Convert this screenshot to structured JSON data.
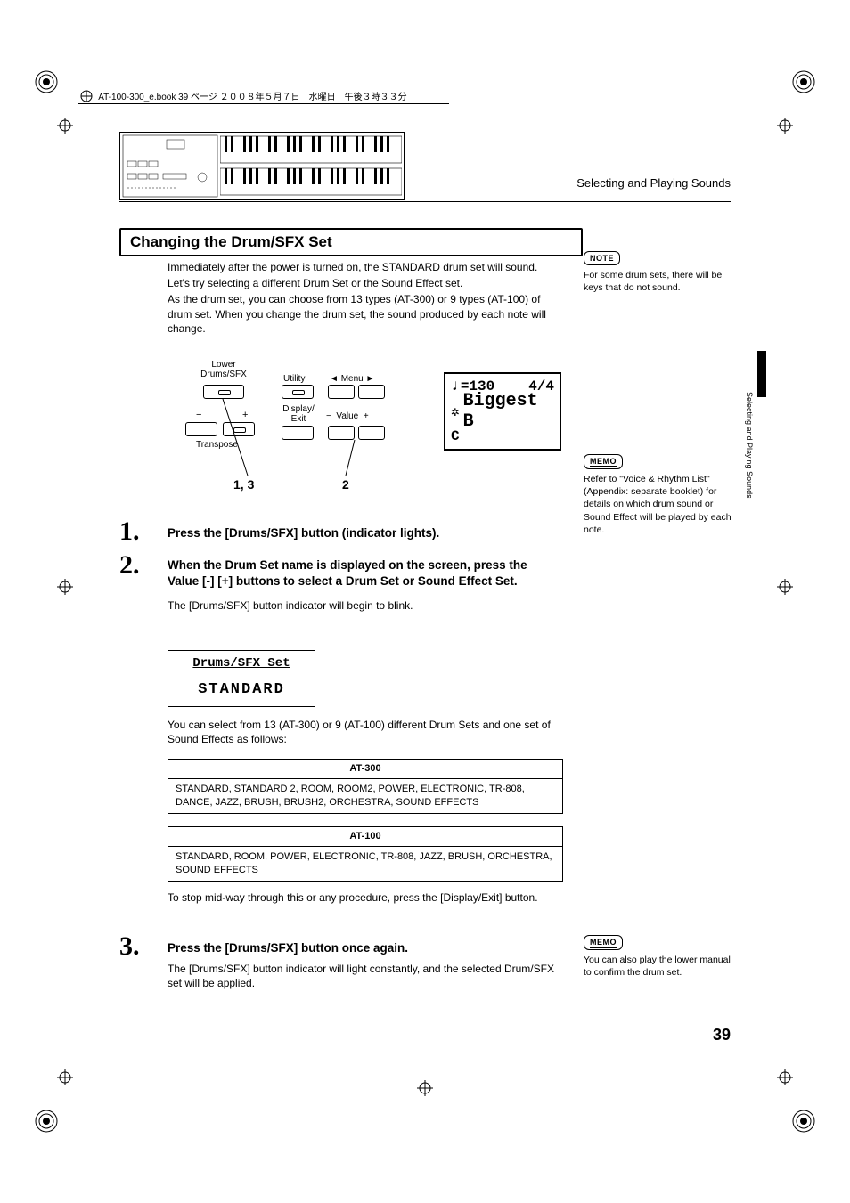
{
  "header_meta": "AT-100-300_e.book  39 ページ  ２００８年５月７日　水曜日　午後３時３３分",
  "breadcrumb": "Selecting and Playing Sounds",
  "section_title": "Changing the Drum/SFX Set",
  "intro": {
    "l1": "Immediately after the power is turned on, the STANDARD drum set will sound.",
    "l2": "Let's try selecting a different Drum Set or the Sound Effect set.",
    "l3": "As the drum set, you can choose from 13 types (AT-300) or 9 types (AT-100) of drum set. When you change the drum set, the sound produced by each note will change."
  },
  "note_badge": "NOTE",
  "note_text": "For some drum sets, there will be keys that do not sound.",
  "panel": {
    "lower_label": "Lower\nDrums/SFX",
    "utility": "Utility",
    "menu": "Menu",
    "display_exit": "Display/\nExit",
    "transpose": "Transpose",
    "value": "Value",
    "minus": "−",
    "plus": "+",
    "callout13": "1, 3",
    "callout2": "2",
    "lcd_tempo": "=130",
    "lcd_sig": "4/4",
    "lcd_name": "Biggest B",
    "lcd_chord_prefix": "C"
  },
  "memo_badge": "MEMO",
  "memo1_text": "Refer to \"Voice & Rhythm List\" (Appendix: separate booklet) for details on which drum sound or Sound Effect will be played by each note.",
  "side_label": "Selecting and Playing Sounds",
  "steps": {
    "s1": {
      "num": "1.",
      "head": "Press the [Drums/SFX] button (indicator lights)."
    },
    "s2": {
      "num": "2.",
      "head": "When the Drum Set name is displayed on the screen, press the Value [-] [+] buttons to select a Drum Set or Sound Effect Set.",
      "body": "The [Drums/SFX] button indicator will begin to blink."
    },
    "s3": {
      "num": "3.",
      "head": "Press the [Drums/SFX] button once again.",
      "body": "The [Drums/SFX] button indicator will light constantly, and the selected Drum/SFX set will be applied."
    }
  },
  "set_lcd": {
    "l1": "Drums/SFX Set",
    "l2": "STANDARD"
  },
  "sets_intro": "You can select from 13 (AT-300) or 9 (AT-100) different Drum Sets and one set of Sound Effects as follows:",
  "tbl300": {
    "title": "AT-300",
    "items": "STANDARD, STANDARD 2, ROOM, ROOM2, POWER, ELECTRONIC, TR-808, DANCE, JAZZ, BRUSH, BRUSH2, ORCHESTRA, SOUND EFFECTS"
  },
  "tbl100": {
    "title": "AT-100",
    "items": "STANDARD, ROOM, POWER, ELECTRONIC, TR-808, JAZZ, BRUSH, ORCHESTRA, SOUND EFFECTS"
  },
  "stop_text": "To stop mid-way through this or any procedure, press the [Display/Exit] button.",
  "memo2_text": "You can also play the lower manual to confirm the drum set.",
  "page_number": "39"
}
